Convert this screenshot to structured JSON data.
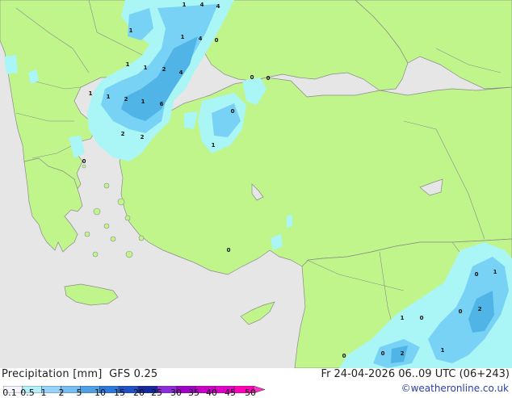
{
  "legend": {
    "title": "Precipitation [mm]",
    "model": "GFS 0.25",
    "ticks": [
      "0.1",
      "0.5",
      "1",
      "2",
      "5",
      "10",
      "15",
      "20",
      "25",
      "30",
      "35",
      "40",
      "45",
      "50"
    ],
    "colors": [
      "#f5f5ff",
      "#b4f0fa",
      "#96d2fa",
      "#78bef0",
      "#50a0e6",
      "#2d78dc",
      "#1e50c8",
      "#1428a0",
      "#8c2ddc",
      "#a000c8",
      "#c800c8",
      "#e100c8",
      "#ff00b4",
      "#ff32c8"
    ]
  },
  "timestamp": "Fr 24-04-2026 06..09 UTC (06+243)",
  "credit": "©weatheronline.co.uk",
  "colors": {
    "land": "#c0f58c",
    "sea": "#e6e6e6",
    "border": "#8a8a8a",
    "light_precip": "#aaf5f5",
    "mid_precip": "#78d2f5",
    "heavy_precip": "#50b4e6"
  },
  "map_labels": [
    "1",
    "4",
    "4",
    "1",
    "1",
    "4",
    "0",
    "1",
    "1",
    "2",
    "4",
    "1",
    "1",
    "2",
    "1",
    "6",
    "2",
    "2",
    "0",
    "0",
    "0",
    "1",
    "0",
    "0",
    "0",
    "1",
    "0",
    "2",
    "0",
    "1",
    "2",
    "0",
    "1",
    "0"
  ]
}
